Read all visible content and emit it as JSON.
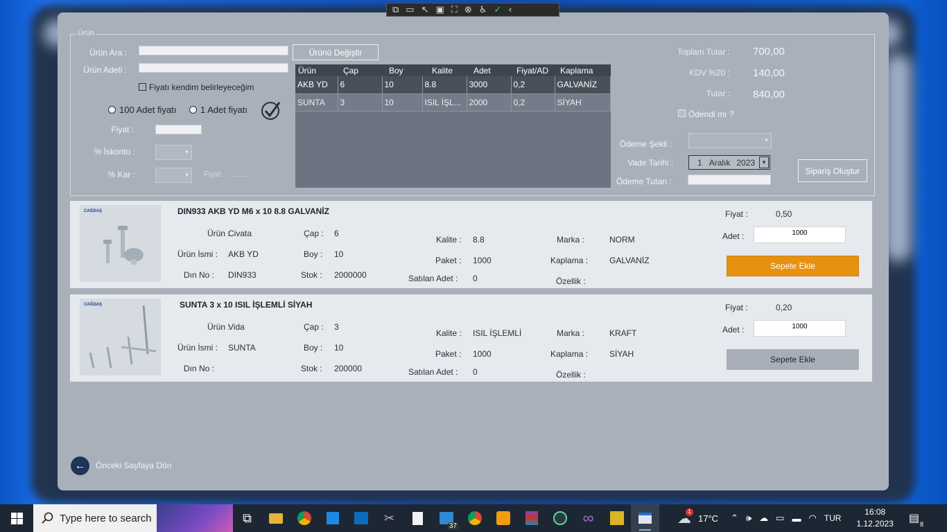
{
  "devbar": {
    "icons": [
      "⧉",
      "▭",
      "↖",
      "▣",
      "⛶",
      "⊗",
      "♿",
      "✓",
      "‹"
    ]
  },
  "order": {
    "group_title": "Ürün",
    "product_search_label": "Ürün Ara :",
    "product_qty_label": "Ürün Adeti :",
    "change_product_button": "Ürünü Değiştir",
    "own_price_label": "Fiyatı kendim belirleyeceğim",
    "radio_100": "100 Adet fiyatı",
    "radio_1": "1 Adet fiyatı",
    "price_label": "Fiyat :",
    "discount_label": "% İskonto :",
    "profit_label": "% Kar :",
    "price_result_label": "Fiyat:",
    "price_result_value": "........"
  },
  "grid": {
    "headers": [
      "Ürün",
      "Çap",
      "Boy",
      "Kalite",
      "Adet",
      "Fiyat/AD",
      "Kaplama"
    ],
    "rows": [
      [
        "AKB YD",
        "6",
        "10",
        "8.8",
        "3000",
        "0,2",
        "GALVANİZ"
      ],
      [
        "SUNTA",
        "3",
        "10",
        "ISIL İŞL...",
        "2000",
        "0,2",
        "SİYAH"
      ]
    ]
  },
  "totals": {
    "total_label": "Toplam Tutar :",
    "total_value": "700,00",
    "vat_label": "KDV %20 :",
    "vat_value": "140,00",
    "amount_label": "Tutar :",
    "amount_value": "840,00",
    "paid_label": "Ödendi mı ?",
    "payment_method_label": "Ödeme Şekli :",
    "due_date_label": "Vade Tarihi :",
    "due_day": "1",
    "due_month": "Aralık",
    "due_year": "2023",
    "payment_amount_label": "Ödeme Tutarı :",
    "create_order_button": "Sipariş Oluştur"
  },
  "products": [
    {
      "title": "DIN933 AKB YD  M6 x 10 8.8 GALVANİZ",
      "urun_label": "Ürün :",
      "urun": "Civata",
      "isim_label": "Ürün İsmi :",
      "isim": "AKB YD",
      "din_label": "Dın No :",
      "din": "DIN933",
      "cap_label": "Çap :",
      "cap": "6",
      "boy_label": "Boy :",
      "boy": "10",
      "stok_label": "Stok :",
      "stok": "2000000",
      "kalite_label": "Kalite :",
      "kalite": "8.8",
      "paket_label": "Paket :",
      "paket": "1000",
      "satilan_label": "Satılan Adet :",
      "satilan": "0",
      "marka_label": "Marka :",
      "marka": "NORM",
      "kaplama_label": "Kaplama :",
      "kaplama": "GALVANİZ",
      "ozellik_label": "Özellik :",
      "ozellik": "",
      "fiyat_label": "Fiyat :",
      "fiyat": "0,50",
      "adet_label": "Adet :",
      "adet": "1000",
      "add_button": "Sepete Ekle",
      "logo": "CAĞDAŞ"
    },
    {
      "title": "SUNTA 3 x 10 ISIL İŞLEMLİ SİYAH",
      "urun_label": "Ürün :",
      "urun": "Vida",
      "isim_label": "Ürün İsmi :",
      "isim": "SUNTA",
      "din_label": "Dın No :",
      "din": "",
      "cap_label": "Çap :",
      "cap": "3",
      "boy_label": "Boy :",
      "boy": "10",
      "stok_label": "Stok :",
      "stok": "200000",
      "kalite_label": "Kalite :",
      "kalite": "ISIL İŞLEMLİ",
      "paket_label": "Paket :",
      "paket": "1000",
      "satilan_label": "Satılan Adet :",
      "satilan": "0",
      "marka_label": "Marka :",
      "marka": "KRAFT",
      "kaplama_label": "Kaplama :",
      "kaplama": "SİYAH",
      "ozellik_label": "Özellik :",
      "ozellik": "",
      "fiyat_label": "Fiyat :",
      "fiyat": "0,20",
      "adet_label": "Adet :",
      "adet": "1000",
      "add_button": "Sepete Ekle",
      "logo": "CAĞDAŞ"
    }
  ],
  "back_label": "Önceki Sayfaya Dön",
  "taskbar": {
    "search_placeholder": "Type here to search",
    "badge_count": "37",
    "weather_temp": "17°C",
    "weather_alert": "1",
    "lang": "TUR",
    "time": "16:08",
    "date": "1.12.2023",
    "notifications": "8"
  },
  "colors": {
    "accent_button": "#e59112",
    "disabled_button": "#a7aeb7",
    "grid_header": "#3f4550"
  }
}
